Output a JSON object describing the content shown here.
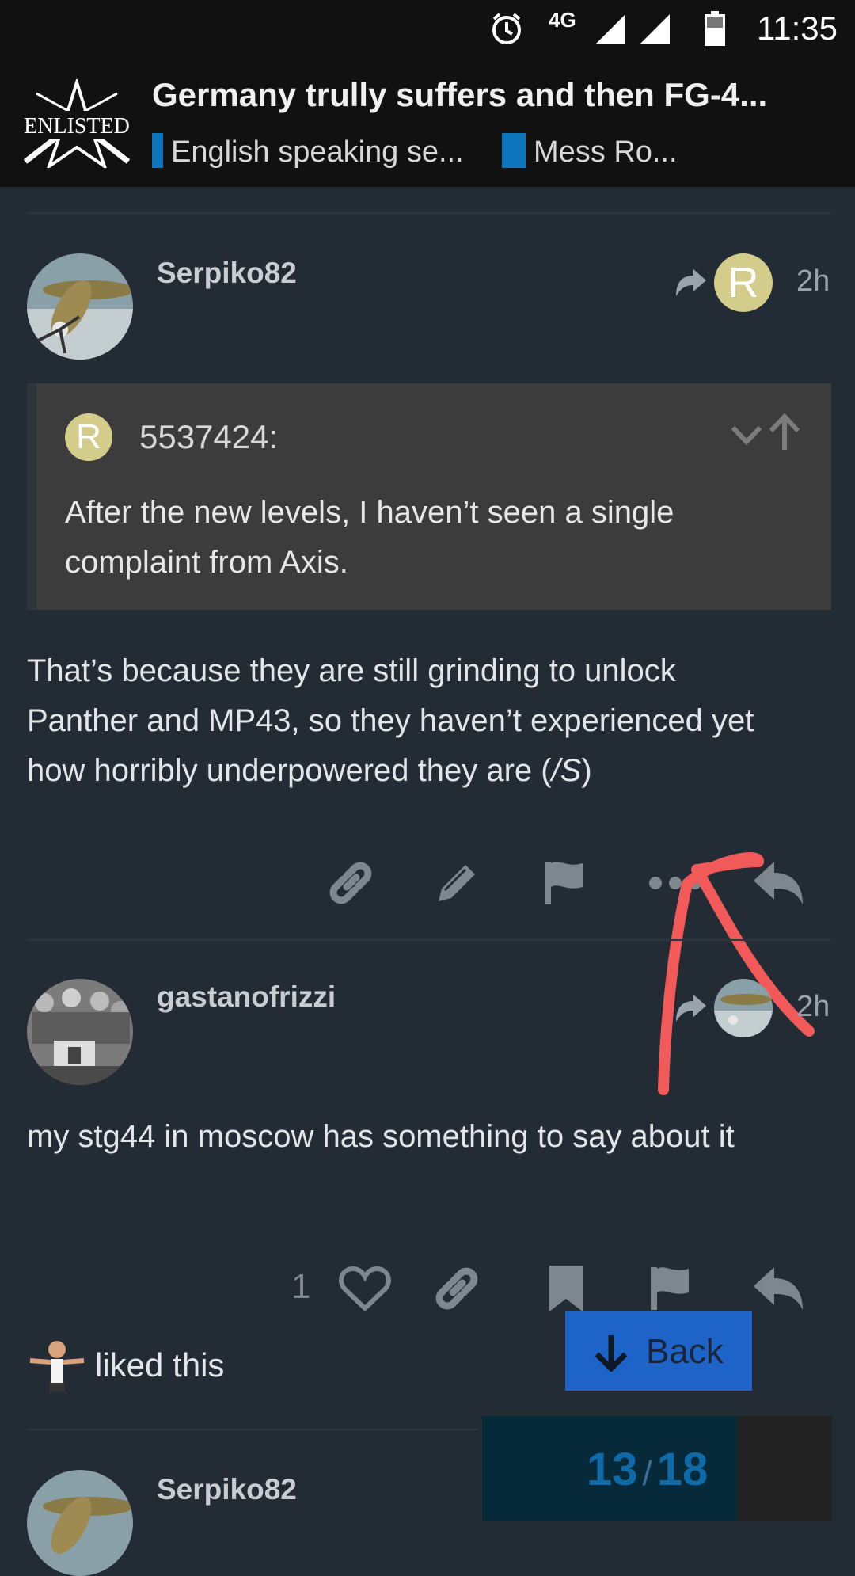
{
  "status_bar": {
    "network": "4G",
    "time": "11:35"
  },
  "header": {
    "logo_text": "ENLISTED",
    "topic_title": "Germany trully suffers and then FG-4...",
    "categories": [
      {
        "label": "English speaking se...",
        "color": "#0e76bd"
      },
      {
        "label": "Mess Ro...",
        "color": "#0e76bd"
      }
    ]
  },
  "posts": [
    {
      "username": "Serpiko82",
      "reply_to_initial": "R",
      "age": "2h",
      "quote": {
        "avatar_initial": "R",
        "username": "5537424:",
        "text": "After the new levels, I haven’t seen a single complaint from Axis."
      },
      "body_line1": "That’s because they are still grinding to unlock",
      "body_line2": "Panther and MP43, so they haven’t experienced yet",
      "body_line3_pre": "how horribly underpowered they are (",
      "body_line3_em": "/S",
      "body_line3_post": ")"
    },
    {
      "username": "gastanofrizzi",
      "age": "2h",
      "body": "my stg44 in moscow has something to say about it",
      "like_count": "1",
      "liked_text": "liked this"
    },
    {
      "username": "Serpiko82"
    }
  ],
  "back_button": {
    "label": "Back"
  },
  "progress": {
    "current": "13",
    "total": "18"
  },
  "colors": {
    "background": "#232c34",
    "header": "#111111",
    "accent_blue": "#1e64c8",
    "annotation_red": "#f25a5a"
  }
}
